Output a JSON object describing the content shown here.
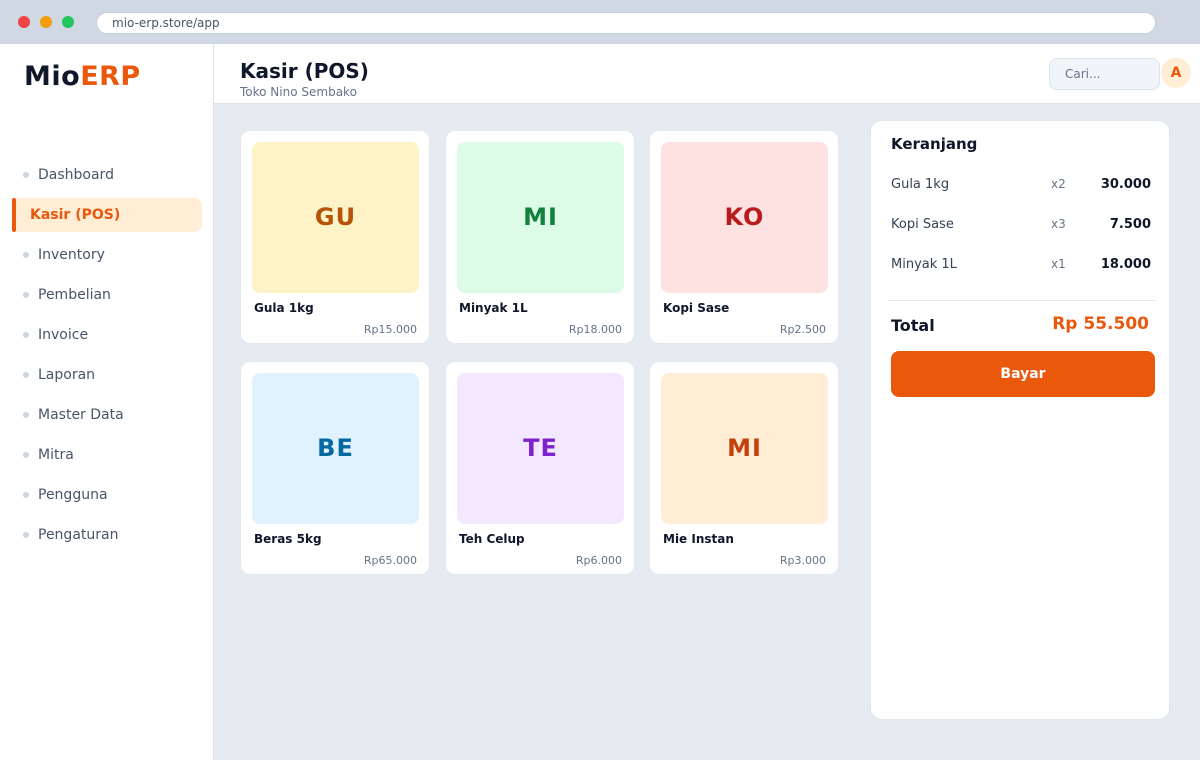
{
  "browser": {
    "url": "mio-erp.store/app"
  },
  "logo": {
    "part1": "Mio",
    "part2": "ERP"
  },
  "sidebar": {
    "items": [
      {
        "label": "Dashboard",
        "active": false
      },
      {
        "label": "Kasir (POS)",
        "active": true
      },
      {
        "label": "Inventory",
        "active": false
      },
      {
        "label": "Pembelian",
        "active": false
      },
      {
        "label": "Invoice",
        "active": false
      },
      {
        "label": "Laporan",
        "active": false
      },
      {
        "label": "Master Data",
        "active": false
      },
      {
        "label": "Mitra",
        "active": false
      },
      {
        "label": "Pengguna",
        "active": false
      },
      {
        "label": "Pengaturan",
        "active": false
      }
    ]
  },
  "header": {
    "title": "Kasir (POS)",
    "subtitle": "Toko Nino Sembako",
    "search_placeholder": "Cari...",
    "avatar_initial": "A"
  },
  "products": [
    {
      "initials": "GU",
      "name": "Gula 1kg",
      "price": "Rp15.000",
      "bg": "#fef3c7",
      "fg": "#b45309"
    },
    {
      "initials": "MI",
      "name": "Minyak 1L",
      "price": "Rp18.000",
      "bg": "#dcfce7",
      "fg": "#15803d"
    },
    {
      "initials": "KO",
      "name": "Kopi Sase",
      "price": "Rp2.500",
      "bg": "#fee2e2",
      "fg": "#b91c1c"
    },
    {
      "initials": "BE",
      "name": "Beras 5kg",
      "price": "Rp65.000",
      "bg": "#e0f2fe",
      "fg": "#0369a1"
    },
    {
      "initials": "TE",
      "name": "Teh Celup",
      "price": "Rp6.000",
      "bg": "#f3e8ff",
      "fg": "#7e22ce"
    },
    {
      "initials": "MI",
      "name": "Mie Instan",
      "price": "Rp3.000",
      "bg": "#ffedd5",
      "fg": "#c2410c"
    }
  ],
  "cart": {
    "title": "Keranjang",
    "items": [
      {
        "name": "Gula 1kg",
        "qty": "x2",
        "subtotal": "30.000"
      },
      {
        "name": "Kopi Sase",
        "qty": "x3",
        "subtotal": "7.500"
      },
      {
        "name": "Minyak 1L",
        "qty": "x1",
        "subtotal": "18.000"
      }
    ],
    "total_label": "Total",
    "total_value": "Rp 55.500",
    "pay_label": "Bayar"
  },
  "colors": {
    "accent": "#ea580c",
    "accent_soft": "#ffedd5"
  }
}
